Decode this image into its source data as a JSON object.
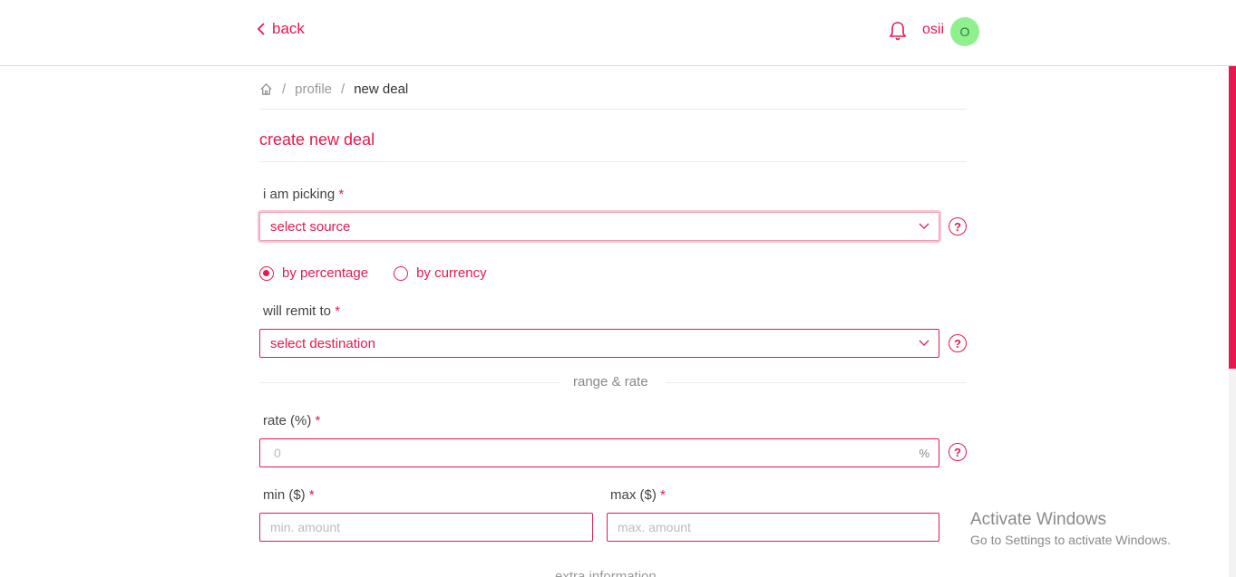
{
  "header": {
    "back_label": "back",
    "username": "osii",
    "avatar_initial": "O"
  },
  "breadcrumb": {
    "items": [
      "profile",
      "new deal"
    ]
  },
  "page_title": "create new deal",
  "form": {
    "picking": {
      "label": "i am picking",
      "required_mark": "*",
      "value": "select source",
      "help": "?"
    },
    "mode": {
      "options": [
        "by percentage",
        "by currency"
      ],
      "selected": "by percentage"
    },
    "remit": {
      "label": "will remit to",
      "required_mark": "*",
      "value": "select destination",
      "help": "?"
    },
    "section_range": "range & rate",
    "rate": {
      "label": "rate (%)",
      "required_mark": "*",
      "value": "0",
      "suffix": "%",
      "help": "?"
    },
    "min": {
      "label": "min ($)",
      "required_mark": "*",
      "placeholder": "min. amount"
    },
    "max": {
      "label": "max ($)",
      "required_mark": "*",
      "placeholder": "max. amount"
    },
    "next_section_partial": "extra information"
  },
  "watermark": {
    "line1": "Activate Windows",
    "line2": "Go to Settings to activate Windows."
  },
  "colors": {
    "accent": "#e8174d",
    "avatar_bg": "#90f090"
  }
}
